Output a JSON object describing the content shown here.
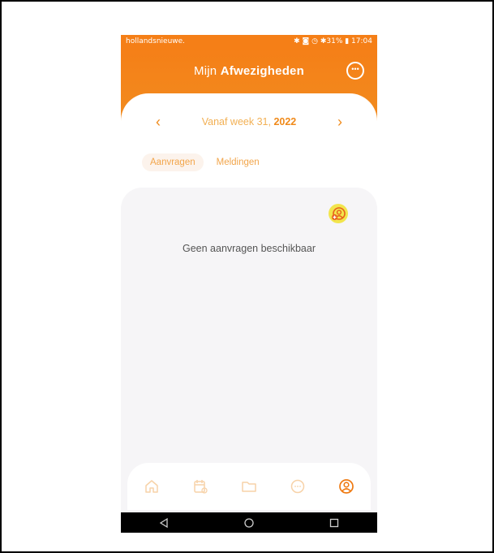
{
  "status_bar": {
    "carrier": "hollandsnieuwe.",
    "right": "✱ ◙ ◷ ✱31% ▮ 17:04"
  },
  "header": {
    "title_prefix": "Mijn",
    "title_bold": "Afwezigheden",
    "chat_icon": "chat-bubble-icon"
  },
  "week_nav": {
    "prefix": "Vanaf week 31,",
    "year": "2022",
    "prev_icon": "chevron-left-icon",
    "next_icon": "chevron-right-icon"
  },
  "tabs": [
    {
      "label": "Aanvragen",
      "active": true
    },
    {
      "label": "Meldingen",
      "active": false
    }
  ],
  "list": {
    "empty_message": "Geen aanvragen beschikbaar",
    "add_icon": "add-person-icon"
  },
  "bottom_nav": [
    {
      "icon": "home-icon",
      "active": false
    },
    {
      "icon": "calendar-icon",
      "active": false
    },
    {
      "icon": "folder-icon",
      "active": false
    },
    {
      "icon": "chat-icon",
      "active": false
    },
    {
      "icon": "profile-icon",
      "active": true
    }
  ],
  "colors": {
    "brand_orange": "#f57f17",
    "accent_orange": "#f08a1a",
    "highlight_yellow": "#f2e54d"
  }
}
